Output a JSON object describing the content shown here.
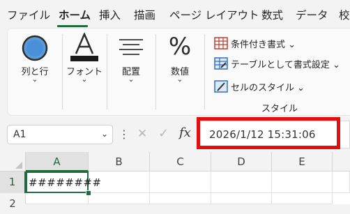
{
  "menu": {
    "tabs": [
      {
        "label": "ファイル"
      },
      {
        "label": "ホーム"
      },
      {
        "label": "挿入"
      },
      {
        "label": "描画"
      },
      {
        "label": "ページ レイアウト"
      },
      {
        "label": "数式"
      },
      {
        "label": "データ"
      },
      {
        "label": "校"
      }
    ],
    "active_index": 1
  },
  "ribbon": {
    "alignment": {
      "label": "列と行",
      "chevron": "⌄"
    },
    "font": {
      "label": "フォント",
      "chevron": "⌄"
    },
    "paragraph": {
      "label": "配置",
      "chevron": "⌄"
    },
    "number": {
      "label": "数値",
      "chevron": "⌄",
      "icon_glyph": "%"
    },
    "styles": {
      "conditional_format": "条件付き書式 ⌄",
      "format_as_table": "テーブルとして書式設定 ⌄",
      "cell_styles": "セルのスタイル ⌄",
      "group_label": "スタイル"
    }
  },
  "formula_bar": {
    "name_box": "A1",
    "name_box_dropdown": "⌄",
    "more_glyph": "⋮",
    "cancel_glyph": "✕",
    "enter_glyph": "✓",
    "fx_label": "fx",
    "value": "2026/1/12  15:31:06"
  },
  "sheet": {
    "columns": [
      "A",
      "B",
      "C",
      "D",
      "E"
    ],
    "rows": [
      "1",
      "2"
    ],
    "active_cell_display": "########"
  },
  "colors": {
    "accent": "#1e6b3f",
    "highlight": "#e01010"
  }
}
